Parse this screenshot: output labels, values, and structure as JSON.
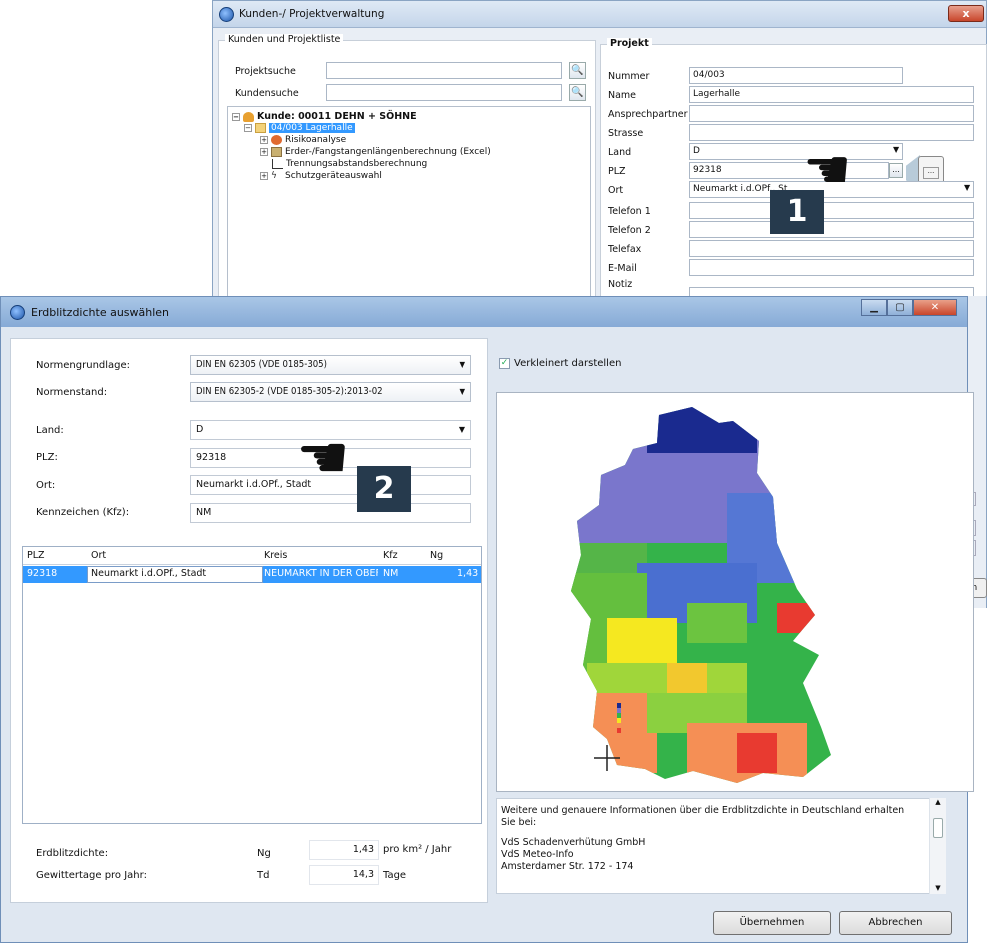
{
  "back_window": {
    "title": "Kunden-/ Projektverwaltung",
    "close_label": "x",
    "left_group": {
      "title": "Kunden und Projektliste",
      "projektsuche_label": "Projektsuche",
      "kundensuche_label": "Kundensuche",
      "tree": {
        "customer": "Kunde: 00011 DEHN + SÖHNE",
        "project": "04/003 Lagerhalle",
        "items": [
          "Risikoanalyse",
          "Erder-/Fangstangenlängenberechnung (Excel)",
          "Trennungsabstandsberechnung",
          "Schutzgeräteauswahl"
        ]
      }
    },
    "project_group": {
      "title": "Projekt",
      "fields": [
        {
          "label": "Nummer",
          "value": "04/003"
        },
        {
          "label": "Name",
          "value": "Lagerhalle"
        },
        {
          "label": "Ansprechpartner",
          "value": ""
        },
        {
          "label": "Strasse",
          "value": ""
        },
        {
          "label": "Land",
          "value": "D"
        },
        {
          "label": "PLZ",
          "value": "92318"
        },
        {
          "label": "Ort",
          "value": "Neumarkt i.d.OPf., St"
        },
        {
          "label": "Telefon 1",
          "value": ""
        },
        {
          "label": "Telefon 2",
          "value": ""
        },
        {
          "label": "Telefax",
          "value": ""
        },
        {
          "label": "E-Mail",
          "value": ""
        },
        {
          "label": "Notiz",
          "value": ""
        }
      ],
      "plz_button": "...",
      "partial_button": "en"
    }
  },
  "callouts": {
    "one": "1",
    "two": "2"
  },
  "dialog": {
    "title": "Erdblitzdichte auswählen",
    "normengrundlage_label": "Normengrundlage:",
    "normengrundlage_value": "DIN EN 62305 (VDE 0185-305)",
    "normenstand_label": "Normenstand:",
    "normenstand_value": "DIN EN 62305-2 (VDE 0185-305-2):2013-02",
    "land_label": "Land:",
    "land_value": "D",
    "plz_label": "PLZ:",
    "plz_value": "92318",
    "ort_label": "Ort:",
    "ort_value": "Neumarkt i.d.OPf., Stadt",
    "kennzeichen_label": "Kennzeichen (Kfz):",
    "kennzeichen_value": "NM",
    "grid": {
      "headers": [
        "PLZ",
        "Ort",
        "Kreis",
        "Kfz",
        "Ng"
      ],
      "rows": [
        [
          "92318",
          "Neumarkt i.d.OPf., Stadt",
          "NEUMARKT IN DER OBEF",
          "NM",
          "1,43"
        ]
      ]
    },
    "erdblitzdichte_label": "Erdblitzdichte:",
    "ng_symbol": "Ng",
    "ng_value": "1,43",
    "ng_unit": "pro km² / Jahr",
    "gewittertage_label": "Gewittertage pro Jahr:",
    "td_symbol": "Td",
    "td_value": "14,3",
    "td_unit": "Tage",
    "checkbox_label": "Verkleinert darstellen",
    "checkbox_checked": true,
    "info_lines": [
      "Weitere und genauere Informationen über die Erdblitzdichte in Deutschland erhalten Sie bei:",
      "",
      "VdS Schadenverhütung GmbH",
      "VdS Meteo-Info",
      "Amsterdamer Str. 172 - 174"
    ],
    "uebernehmen_label": "Übernehmen",
    "abbrechen_label": "Abbrechen"
  }
}
